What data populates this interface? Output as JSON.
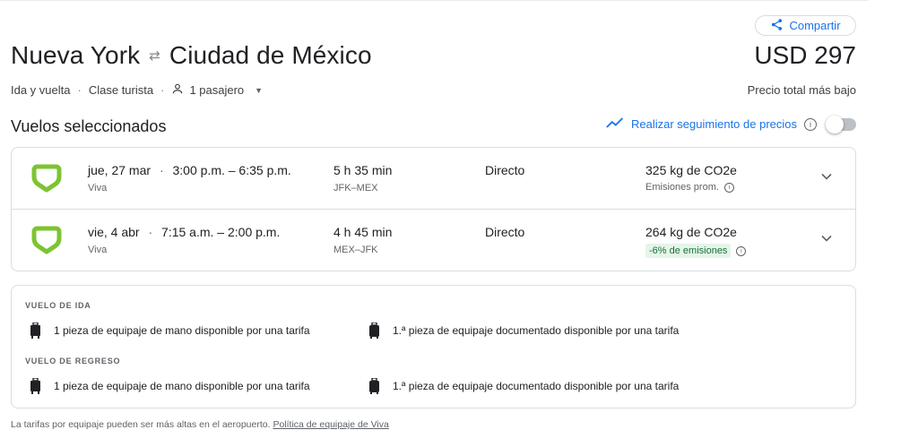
{
  "header": {
    "share_label": "Compartir",
    "origin": "Nueva York",
    "destination": "Ciudad de México",
    "price": "USD 297",
    "trip_type": "Ida y vuelta",
    "cabin": "Clase turista",
    "passengers": "1 pasajero",
    "price_caption": "Precio total más bajo"
  },
  "selected": {
    "title": "Vuelos seleccionados",
    "track_label": "Realizar seguimiento de precios",
    "track_enabled": false
  },
  "flights": [
    {
      "date": "jue, 27 mar",
      "times": "3:00 p.m. – 6:35 p.m.",
      "airline": "Viva",
      "duration": "5 h 35 min",
      "route": "JFK–MEX",
      "stops": "Directo",
      "emissions": "325 kg de CO2e",
      "emissions_note": "Emisiones prom.",
      "emissions_badge": ""
    },
    {
      "date": "vie, 4 abr",
      "times": "7:15 a.m. – 2:00 p.m.",
      "airline": "Viva",
      "duration": "4 h 45 min",
      "route": "MEX–JFK",
      "stops": "Directo",
      "emissions": "264 kg de CO2e",
      "emissions_note": "",
      "emissions_badge": "-6% de emisiones"
    }
  ],
  "baggage": {
    "outbound_label": "VUELO DE IDA",
    "return_label": "VUELO DE REGRESO",
    "carry_on": "1 pieza de equipaje de mano disponible por una tarifa",
    "checked": "1.ª pieza de equipaje documentado disponible por una tarifa"
  },
  "footer": {
    "note": "La tarifas por equipaje pueden ser más altas en el aeropuerto.",
    "link": "Política de equipaje de Viva"
  },
  "colors": {
    "accent": "#1a73e8",
    "airline_logo": "#7cc431",
    "badge_bg": "#e6f4ea",
    "badge_text": "#137333"
  }
}
